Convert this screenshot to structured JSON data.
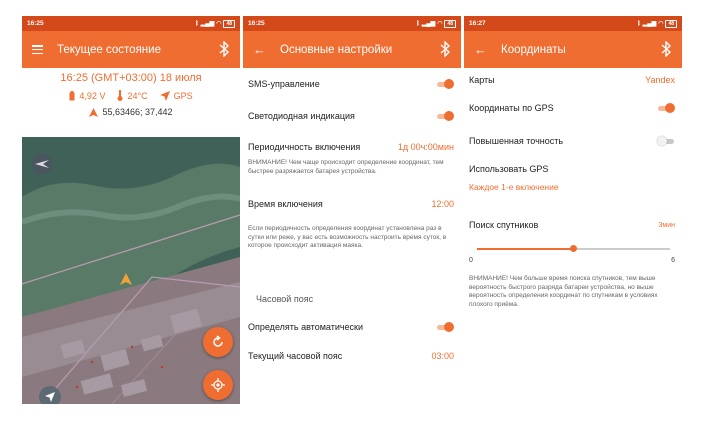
{
  "colors": {
    "accent": "#f06d31",
    "statusbar": "#d4491a",
    "map": "#3f6157"
  },
  "screen1": {
    "status_time": "16:25",
    "battery": "48",
    "title": "Текущее состояние",
    "datetime": "16:25 (GMT+03:00) 18 июля",
    "voltage": "4,92 V",
    "temperature": "24°C",
    "source": "GPS",
    "coordinates": "55,63466;  37,442"
  },
  "screen2": {
    "status_time": "16:25",
    "battery": "48",
    "title": "Основные настройки",
    "sms_label": "SMS-управление",
    "sms_on": true,
    "led_label": "Светодиодная индикация",
    "led_on": true,
    "period_label": "Периодичность включения",
    "period_value": "1д 00ч:00мин",
    "period_note": "ВНИМАНИЕ! Чем чаще происходит определение координат, тем быстрее разряжается батарея устройства.",
    "time_label": "Время включения",
    "time_value": "12:00",
    "time_note": "Если периодичность определения координат установлена раз в сутки или реже, у вас есть возможность настроить время суток, в которое происходит активация маяка.",
    "tz_section": "Часовой пояс",
    "auto_label": "Определять автоматически",
    "auto_on": true,
    "current_tz_label": "Текущий часовой пояс",
    "current_tz_value": "03:00"
  },
  "screen3": {
    "status_time": "16:27",
    "battery": "48",
    "title": "Координаты",
    "maps_label": "Карты",
    "maps_value": "Yandex",
    "gps_label": "Координаты по GPS",
    "gps_on": true,
    "accuracy_label": "Повышенная точность",
    "accuracy_on": false,
    "use_gps_label": "Использовать GPS",
    "use_gps_value": "Каждое 1-е включение",
    "search_label": "Поиск спутников",
    "search_value": "3мин",
    "slider_min": "0",
    "slider_max": "6",
    "slider_value": 3,
    "warning": "ВНИМАНИЕ! Чем больше время поиска спутников, тем выше вероятность быстрого разряда батареи устройства, но выше вероятность определения координат по спутникам в условиях плохого приёма."
  }
}
